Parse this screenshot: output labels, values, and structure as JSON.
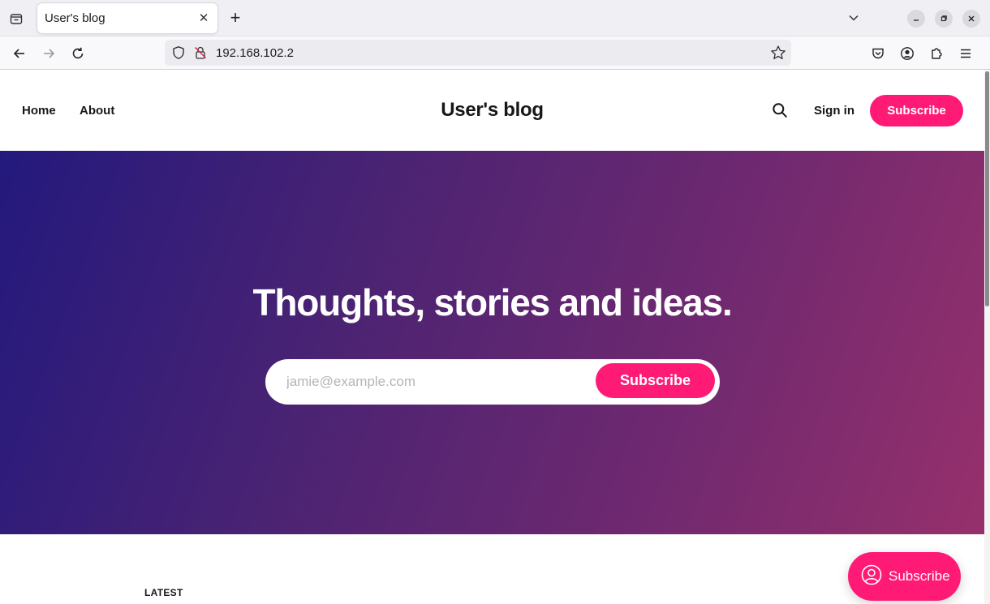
{
  "browser": {
    "tab_title": "User's blog",
    "close_glyph": "✕",
    "new_tab_glyph": "+",
    "url": "192.168.102.2",
    "icons": {
      "tab_list": "tab-list-icon",
      "tabs_dropdown": "chevron-down-icon",
      "minimize": "minimize-icon",
      "restore": "restore-icon",
      "close_window": "close-icon",
      "back": "back-arrow-icon",
      "forward": "forward-arrow-icon",
      "reload": "reload-icon",
      "tracking": "shield-icon",
      "insecure": "insecure-lock-icon",
      "bookmark": "star-icon",
      "pocket": "pocket-icon",
      "account": "account-icon",
      "extensions": "extensions-icon",
      "menu": "hamburger-menu-icon"
    }
  },
  "site": {
    "nav": [
      "Home",
      "About"
    ],
    "title": "User's blog",
    "sign_in": "Sign in",
    "subscribe": "Subscribe",
    "search_icon": "search-icon"
  },
  "hero": {
    "title": "Thoughts, stories and ideas.",
    "email_placeholder": "jamie@example.com",
    "subscribe": "Subscribe",
    "gradient_start": "#23197d",
    "gradient_end": "#96306c"
  },
  "feed": {
    "section_label": "LATEST"
  },
  "portal": {
    "label": "Subscribe",
    "icon": "user-circle-icon"
  },
  "colors": {
    "accent": "#ff1a75"
  }
}
